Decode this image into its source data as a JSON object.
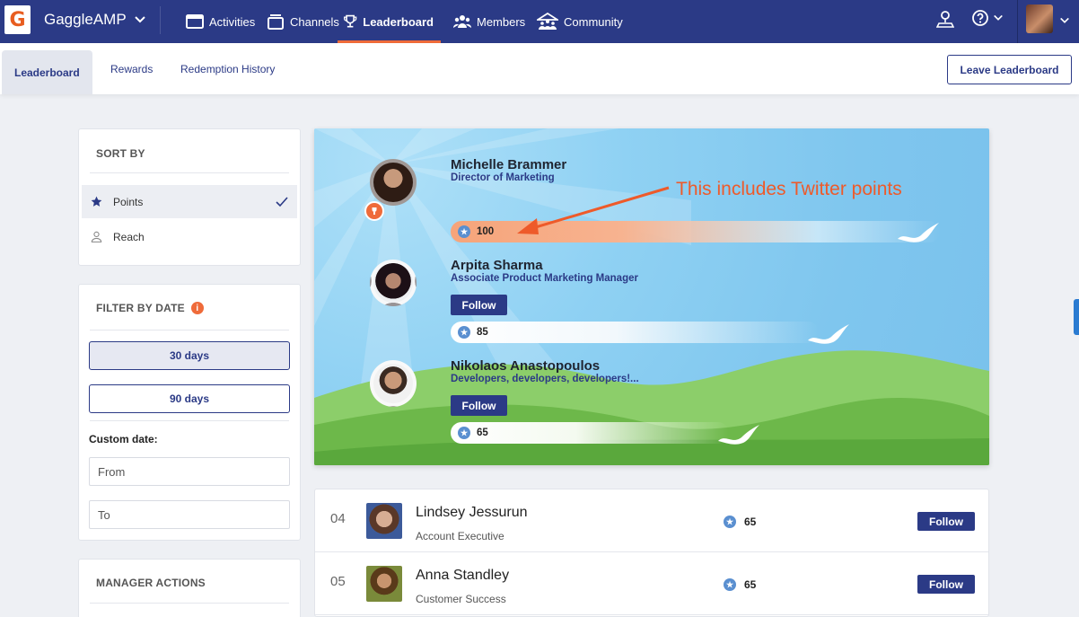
{
  "topbar": {
    "app_name": "GaggleAMP",
    "nav": [
      {
        "label": "Activities",
        "icon": "activities-icon"
      },
      {
        "label": "Channels",
        "icon": "channels-icon"
      },
      {
        "label": "Leaderboard",
        "icon": "trophy-icon",
        "active": true
      },
      {
        "label": "Members",
        "icon": "members-icon"
      },
      {
        "label": "Community",
        "icon": "community-icon"
      }
    ]
  },
  "subnav": {
    "tabs": [
      {
        "label": "Leaderboard",
        "active": true
      },
      {
        "label": "Rewards"
      },
      {
        "label": "Redemption History"
      }
    ],
    "leave_label": "Leave Leaderboard"
  },
  "sort": {
    "title": "SORT BY",
    "items": [
      {
        "label": "Points",
        "icon": "star-icon",
        "selected": true
      },
      {
        "label": "Reach",
        "icon": "person-icon"
      }
    ]
  },
  "filter": {
    "title": "FILTER BY DATE",
    "buttons": [
      {
        "label": "30 days",
        "selected": true
      },
      {
        "label": "90 days"
      }
    ],
    "custom_label": "Custom date:",
    "from_placeholder": "From",
    "to_placeholder": "To"
  },
  "manager": {
    "title": "MANAGER ACTIONS"
  },
  "podium": [
    {
      "name": "Michelle Brammer",
      "role": "Director of Marketing",
      "points": "100",
      "follow": false
    },
    {
      "name": "Arpita Sharma",
      "role": "Associate Product Marketing Manager",
      "points": "85",
      "follow": true
    },
    {
      "name": "Nikolaos Anastopoulos",
      "role": "Developers, developers, developers!...",
      "points": "65",
      "follow": true
    }
  ],
  "annotation": "This includes Twitter points",
  "follow_label": "Follow",
  "list": [
    {
      "rank": "04",
      "name": "Lindsey Jessurun",
      "role": "Account Executive",
      "points": "65"
    },
    {
      "rank": "05",
      "name": "Anna Standley",
      "role": "Customer Success",
      "points": "65"
    }
  ],
  "colors": {
    "brand": "#2b3a86",
    "accent": "#ef6b3a",
    "annotation": "#ee5a2a"
  }
}
